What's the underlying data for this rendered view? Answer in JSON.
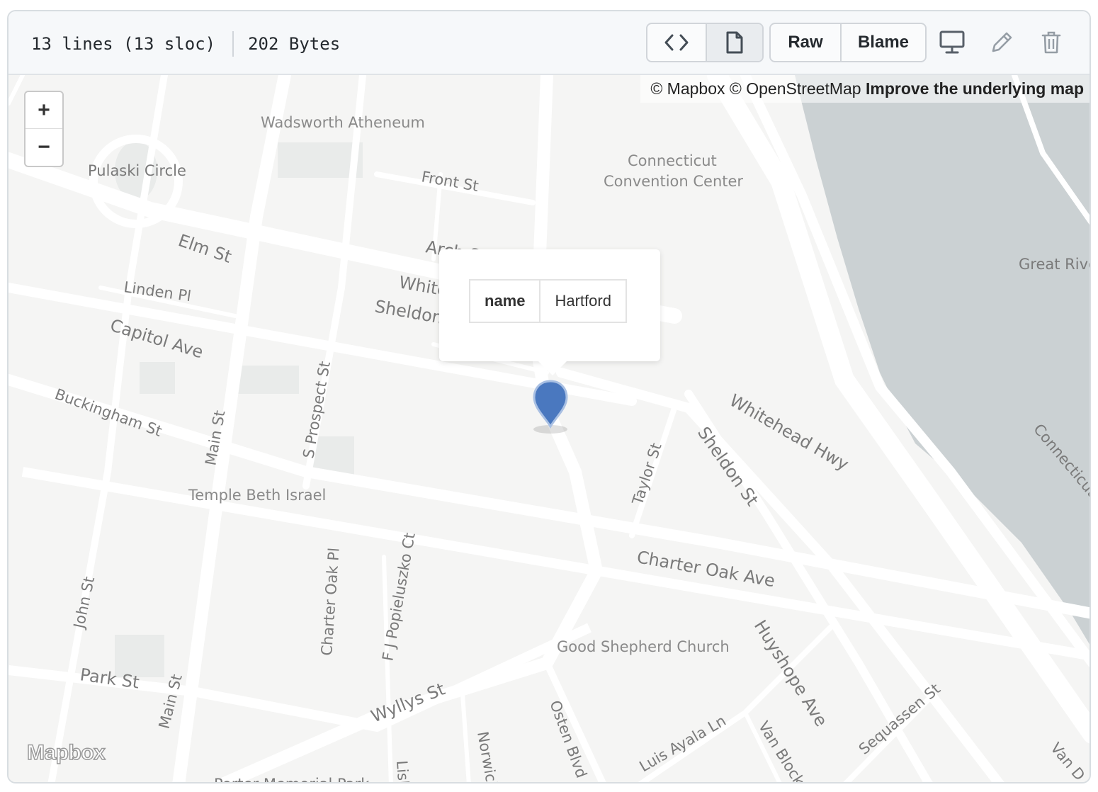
{
  "file_info": {
    "lines": "13 lines (13 sloc)",
    "size": "202 Bytes"
  },
  "toolbar": {
    "code_icon": "code-icon",
    "file_icon": "file-icon",
    "raw_label": "Raw",
    "blame_label": "Blame",
    "desktop_icon": "desktop-icon",
    "edit_icon": "pencil-icon",
    "delete_icon": "trash-icon"
  },
  "map": {
    "attribution_mapbox": "© Mapbox",
    "attribution_osm": "© OpenStreetMap",
    "attribution_improve": "Improve the underlying map",
    "zoom_in": "+",
    "zoom_out": "−",
    "logo": "Mapbox",
    "popup": {
      "key": "name",
      "value": "Hartford"
    },
    "labels": {
      "wadsworth": "Wadsworth Atheneum",
      "pulaski": "Pulaski Circle",
      "front": "Front St",
      "convention1": "Connecticut",
      "convention2": "Convention Center",
      "elm": "Elm St",
      "arch": "Arch St",
      "linden": "Linden Pl",
      "white": "White",
      "sheldon1": "Sheldon",
      "capitol": "Capitol Ave",
      "great_river": "Great Rive",
      "buckingham": "Buckingham St",
      "prospect": "S Prospect St",
      "main1": "Main St",
      "whitehead": "Whitehead Hwy",
      "sheldon2": "Sheldon St",
      "taylor": "Taylor St",
      "connecticut_river": "Connecticut",
      "temple": "Temple Beth Israel",
      "popieluszko": "F J Popieluszko Ct",
      "charter_oak_pl": "Charter Oak Pl",
      "charter_oak_ave": "Charter Oak Ave",
      "john": "John St",
      "good_shepherd": "Good Shepherd Church",
      "huyshope": "Huyshope Ave",
      "park": "Park St",
      "main2": "Main St",
      "wyllys": "Wyllys St",
      "osten": "Osten Blvd",
      "norwich": "Norwich",
      "lisbon": "Lisb",
      "luis": "Luis Ayala Ln",
      "van_block": "Van Block A",
      "sequassen": "Sequassen St",
      "van_d": "Van D",
      "porter": "Porter Memorial Park"
    }
  }
}
